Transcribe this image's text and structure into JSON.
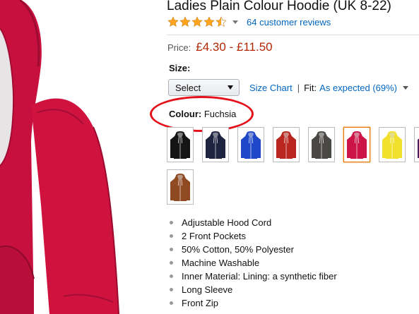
{
  "product": {
    "title": "Ladies Plain Colour Hoodie (UK 8-22)",
    "rating": 4.5,
    "reviews_text": "64 customer reviews",
    "price_label": "Price:",
    "price_value": "£4.30 - £11.50"
  },
  "size": {
    "label": "Size:",
    "select_value": "Select",
    "size_chart_link": "Size Chart",
    "separator": "|",
    "fit_label": "Fit:",
    "fit_value": "As expected (69%)"
  },
  "colour": {
    "label": "Colour:",
    "selected": "Fuchsia",
    "highlight_color": "#e5101a",
    "swatches": [
      {
        "color": "#151515",
        "trim": "#ffffff",
        "selected": false
      },
      {
        "color": "#1e2340",
        "trim": "#ffffff",
        "selected": false
      },
      {
        "color": "#1f48c9",
        "trim": "#ffffff",
        "selected": false
      },
      {
        "color": "#b8261f",
        "trim": "#ffffff",
        "selected": false
      },
      {
        "color": "#4a4844",
        "trim": "#ffffff",
        "selected": false
      },
      {
        "color": "#cc1449",
        "trim": "#ffffff",
        "selected": true
      },
      {
        "color": "#f2e12c",
        "trim": "#ffffff",
        "selected": false
      },
      {
        "color": "#4b1c5c",
        "trim": "#ffffff",
        "selected": false
      },
      {
        "color": "#8f4a22",
        "trim": "#ffffff",
        "selected": false
      }
    ]
  },
  "features": [
    "Adjustable Hood Cord",
    "2 Front Pockets",
    "50% Cotton, 50% Polyester",
    "Machine Washable",
    "Inner Material: Lining: a synthetic fiber",
    "Long Sleeve",
    "Front Zip"
  ],
  "colors": {
    "link": "#0066c0",
    "price": "#b12704",
    "star": "#ffa41c",
    "hoodie_main": "#c8103f"
  },
  "icons": {
    "star": "star-icon",
    "half_star": "half-star-icon",
    "caret": "chevron-down-icon"
  }
}
